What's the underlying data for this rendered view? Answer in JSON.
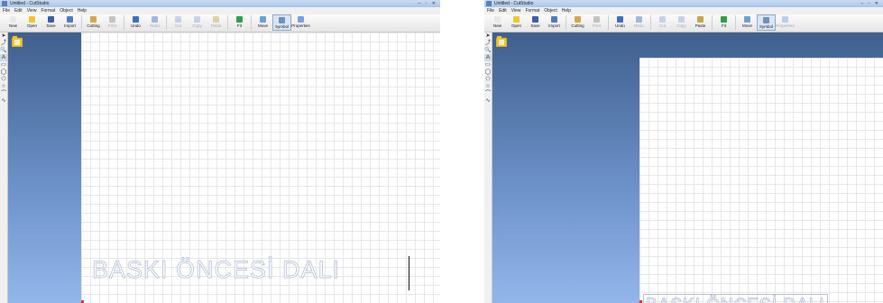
{
  "app": {
    "title": "Untitled - CutStudio"
  },
  "menu": [
    "File",
    "Edit",
    "View",
    "Format",
    "Object",
    "Help"
  ],
  "toolbar": [
    {
      "label": "New",
      "icon": "new-icon",
      "color": "#e8e8e8",
      "enabled": true
    },
    {
      "label": "Open",
      "icon": "open-icon",
      "color": "#f2c530",
      "enabled": true
    },
    {
      "label": "Save",
      "icon": "save-icon",
      "color": "#3a5da8",
      "enabled": true
    },
    {
      "label": "Import",
      "icon": "import-icon",
      "color": "#4c7ac4",
      "enabled": true
    },
    {
      "label": "Cutting",
      "icon": "cutting-icon",
      "color": "#d9a44a",
      "enabled": true
    },
    {
      "label": "Print",
      "icon": "print-icon",
      "color": "#888888",
      "enabled": false
    },
    {
      "label": "Undo",
      "icon": "undo-icon",
      "color": "#3b6fc4",
      "enabled": true
    },
    {
      "label": "Redo",
      "icon": "redo-icon",
      "color": "#3b6fc4",
      "enabled": false
    },
    {
      "label": "Cut",
      "icon": "cut-icon",
      "color": "#8aa8d8",
      "enabled": false
    },
    {
      "label": "Copy",
      "icon": "copy-icon",
      "color": "#8aa8d8",
      "enabled": false
    },
    {
      "label": "Paste",
      "icon": "paste-icon",
      "color": "#c9a24a",
      "enabled": false
    },
    {
      "label": "Fit",
      "icon": "fit-icon",
      "color": "#2e9e4a",
      "enabled": true
    },
    {
      "label": "Move",
      "icon": "move-icon",
      "color": "#6aa0d8",
      "enabled": true
    },
    {
      "label": "Symbol",
      "icon": "symbol-icon",
      "color": "#6f8fbf",
      "enabled": true,
      "active": true
    },
    {
      "label": "Properties",
      "icon": "properties-icon",
      "color": "#6fa0e8",
      "enabled": true
    }
  ],
  "right_toolbar_overrides": {
    "paste_enabled": true,
    "properties_enabled": false
  },
  "left_tools": [
    {
      "glyph": "➤",
      "icon": "select-arrow-icon"
    },
    {
      "glyph": "⤴",
      "icon": "node-edit-icon"
    },
    {
      "glyph": "🔍",
      "icon": "zoom-icon"
    },
    {
      "glyph": "A",
      "icon": "text-tool-icon",
      "selected": true
    },
    {
      "glyph": "▭",
      "icon": "rectangle-tool-icon"
    },
    {
      "glyph": "◯",
      "icon": "ellipse-tool-icon"
    },
    {
      "glyph": "⬠",
      "icon": "polygon-tool-icon"
    },
    {
      "glyph": "☆",
      "icon": "star-tool-icon"
    },
    {
      "glyph": "⌒",
      "icon": "bezier-tool-icon"
    },
    {
      "glyph": "∿",
      "icon": "freehand-tool-icon"
    }
  ],
  "canvas": {
    "text": "BASKI ÖNCESİ DALI"
  }
}
